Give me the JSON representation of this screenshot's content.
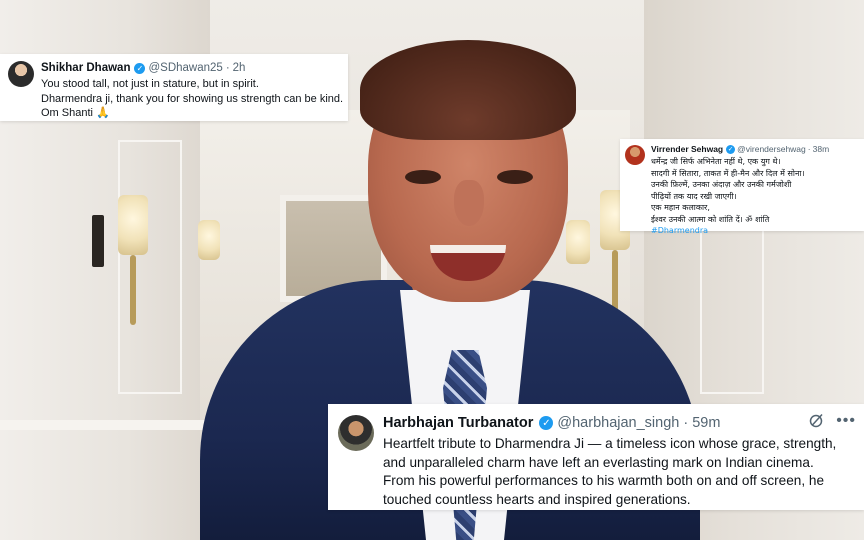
{
  "tweets": [
    {
      "name": "Shikhar Dhawan",
      "handle": "@SDhawan25",
      "separator": "·",
      "time": "2h",
      "lines": [
        "You stood tall, not just in stature, but in spirit.",
        "Dharmendra ji, thank you for showing us strength can be kind.",
        "Om Shanti 🙏"
      ]
    },
    {
      "name": "Virrender Sehwag",
      "handle": "@virendersehwag",
      "separator": "·",
      "time": "38m",
      "lines": [
        "धर्मेन्द्र जी सिर्फ अभिनेता नहीं थे, एक युग थे।",
        "सादगी में सितारा, ताकत में ही-मैन और दिल में सोना।",
        "उनकी फ़िल्में, उनका अंदाज़ और उनकी गर्मजोशी",
        "पीढ़ियों तक याद रखी जाएगी।",
        "एक महान कलाकार,",
        "ईश्वर उनकी आत्मा को शांति दें। ॐ शांति"
      ],
      "hashtag": "#Dharmendra"
    },
    {
      "name": "Harbhajan Turbanator",
      "handle": "@harbhajan_singh",
      "separator": "·",
      "time": "59m",
      "lines": [
        "Heartfelt tribute to Dharmendra Ji — a timeless icon whose grace, strength,",
        "and unparalleled charm have left an everlasting mark on Indian cinema.",
        "From his powerful performances to his warmth both on and off screen, he",
        "touched countless hearts and inspired generations."
      ],
      "icons": [
        "grok-icon",
        "more-icon"
      ]
    }
  ],
  "colors": {
    "accent": "#1d9bf0",
    "text": "#0f1419",
    "muted": "#536471",
    "jacket": "#1b2850"
  }
}
